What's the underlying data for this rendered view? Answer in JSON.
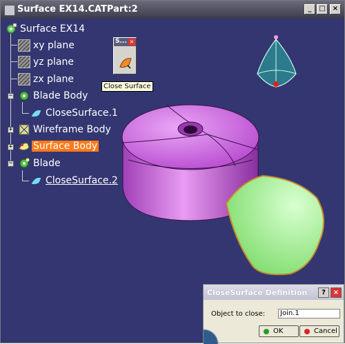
{
  "window": {
    "title": "Surface EX14.CATPart:2",
    "buttons": {
      "minimize": "_",
      "maximize": "□",
      "close": "×"
    }
  },
  "tree": {
    "root": "Surface EX14",
    "items": [
      {
        "label": "xy plane",
        "icon": "plane-icon"
      },
      {
        "label": "yz plane",
        "icon": "plane-icon"
      },
      {
        "label": "zx plane",
        "icon": "plane-icon"
      },
      {
        "label": "Blade Body",
        "icon": "body-icon"
      },
      {
        "label": "CloseSurface.1",
        "icon": "close-surface-icon"
      },
      {
        "label": "Wireframe Body",
        "icon": "wireframe-body-icon"
      },
      {
        "label": "Surface Body",
        "icon": "surface-body-icon",
        "selected": true
      },
      {
        "label": "Blade",
        "icon": "gear-body-icon"
      },
      {
        "label": "CloseSurface.2",
        "icon": "close-surface-icon",
        "underlined": true
      }
    ]
  },
  "mini_toolbar": {
    "title": "S...",
    "close": "×"
  },
  "tooltip": {
    "text": "Close Surface"
  },
  "dialog": {
    "title": "CloseSurface Definition",
    "help_button": "?",
    "close_button": "×",
    "object_label": "Object to close:",
    "object_value": "Join.1",
    "ok_label": "OK",
    "cancel_label": "Cancel"
  },
  "colors": {
    "background": "#333670",
    "selection": "#ff7a1a",
    "part_fill": "#cc66dd",
    "surface_fill": "#99ee88",
    "compass": "#2c7a8c"
  }
}
